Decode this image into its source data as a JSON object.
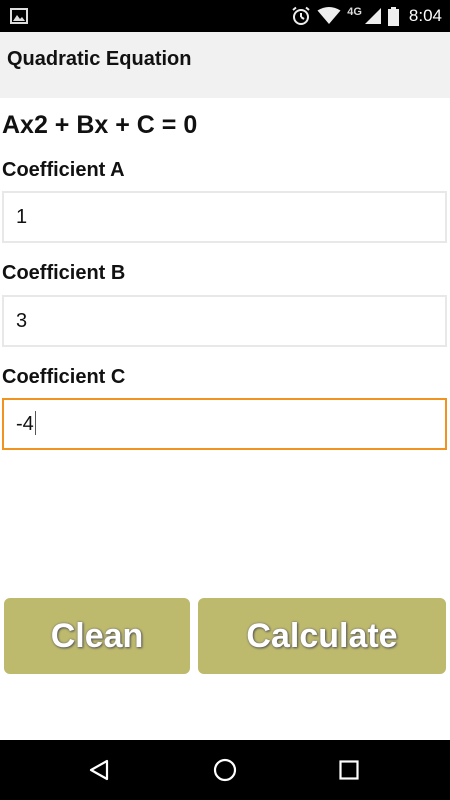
{
  "status_bar": {
    "network_label": "4G",
    "time": "8:04",
    "icons": [
      "image-notification-icon",
      "alarm-icon",
      "wifi-icon",
      "cellular-signal-icon",
      "battery-icon"
    ]
  },
  "app_bar": {
    "title": "Quadratic Equation"
  },
  "form": {
    "equation": "Ax2 + Bx + C = 0",
    "coefficient_a": {
      "label": "Coefficient A",
      "value": "1"
    },
    "coefficient_b": {
      "label": "Coefficient B",
      "value": "3"
    },
    "coefficient_c": {
      "label": "Coefficient C",
      "value": "-4"
    }
  },
  "buttons": {
    "clean_label": "Clean",
    "calculate_label": "Calculate",
    "color": "#bdb96d"
  },
  "colors": {
    "focus_border": "#f0941f",
    "app_bar_bg": "#f1f1f1"
  },
  "nav_bar": {
    "icons": [
      "back-icon",
      "home-icon",
      "recents-icon"
    ]
  }
}
